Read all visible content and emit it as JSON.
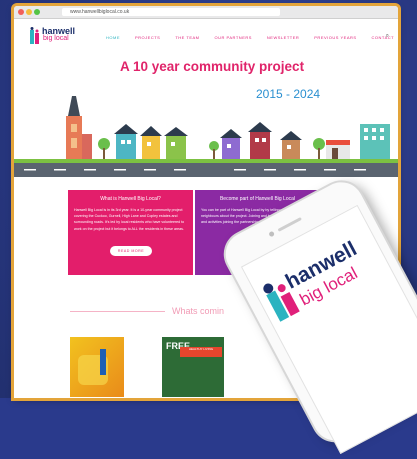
{
  "browser": {
    "url": "www.hanwellbiglocal.co.uk"
  },
  "logo": {
    "line1": "hanwell",
    "line2": "big local"
  },
  "nav": {
    "items": [
      {
        "label": "HOME",
        "active": true
      },
      {
        "label": "PROJECTS",
        "active": false
      },
      {
        "label": "THE TEAM",
        "active": false
      },
      {
        "label": "OUR PARTNERS",
        "active": false
      },
      {
        "label": "NEWSLETTER",
        "active": false
      },
      {
        "label": "PREVIOUS YEARS",
        "active": false
      },
      {
        "label": "CONTACT",
        "active": false
      }
    ]
  },
  "hero": {
    "headline": "A 10 year community project",
    "years": "2015 - 2024"
  },
  "cards": [
    {
      "title": "What is Hanwell Big Local?",
      "text": "Hanwell Big Local is in its 3rd year. It is a 10-year community project covering the Cuckoo, Gurnell, High Lane and Copley estates and surrounding roads. It's led by local residents who have volunteered to work on the project but it belongs to ALL the residents in these areas.",
      "button": "READ MORE"
    },
    {
      "title": "Become part of Hanwell Big Local",
      "text": "You can be part of Hanwell Big Local by by telling your friends and neighbours about the project. Joining and benefitting from the projects and activities joining the partnership. Keeping up-to-date with us"
    }
  ],
  "section": {
    "whats_coming": "Whats comin"
  },
  "thumbs": {
    "free_label": "FREE",
    "strip": "HEALTHY LIVING"
  },
  "phone_logo": {
    "line1": "hanwell",
    "line2": "big local"
  },
  "colors": {
    "pink": "#e31e6b",
    "purple": "#8b2aa3",
    "teal": "#2bb3c0",
    "navy": "#1b2e6a",
    "frame": "#e3a43a"
  }
}
